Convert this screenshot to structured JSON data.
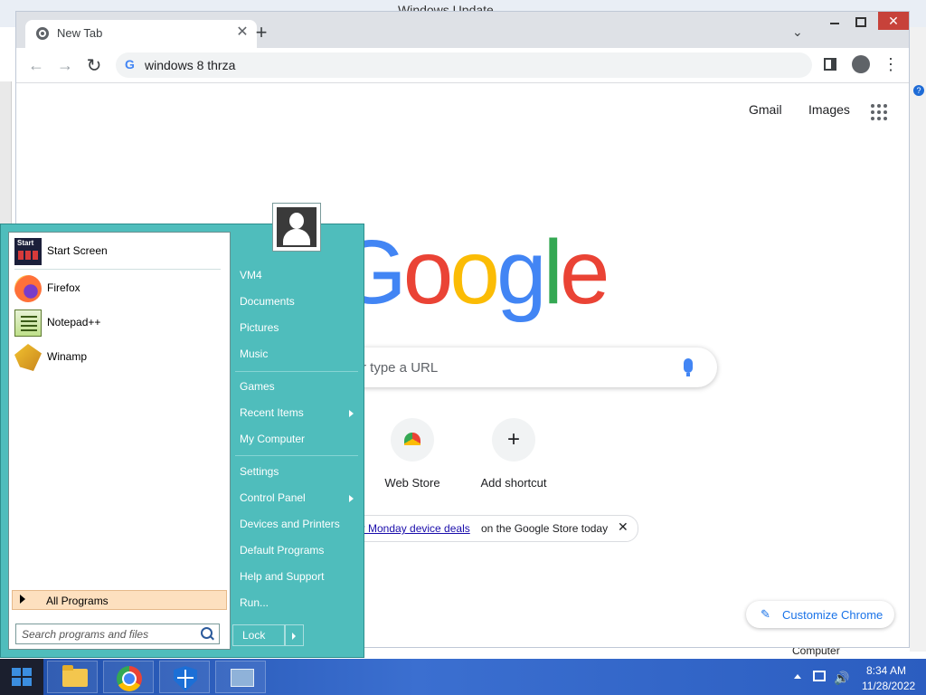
{
  "background_window": {
    "title": "Windows Update",
    "computer_label": "Computer",
    "help_glyph": "?"
  },
  "browser": {
    "tab": {
      "title": "New Tab",
      "close_glyph": "✕"
    },
    "new_tab_glyph": "+",
    "tab_search_glyph": "⌄",
    "close_glyph": "✕",
    "nav": {
      "back_glyph": "←",
      "forward_glyph": "→",
      "reload_glyph": "↻"
    },
    "omnibox": {
      "g_glyph": "G",
      "value": "windows 8 thrza"
    },
    "menu_glyph": "⋮",
    "top_links": {
      "gmail": "Gmail",
      "images": "Images"
    },
    "logo_letters": [
      {
        "ch": "G",
        "color": "#4285f4"
      },
      {
        "ch": "o",
        "color": "#ea4335"
      },
      {
        "ch": "o",
        "color": "#fbbc05"
      },
      {
        "ch": "g",
        "color": "#4285f4"
      },
      {
        "ch": "l",
        "color": "#34a853"
      },
      {
        "ch": "e",
        "color": "#ea4335"
      }
    ],
    "search_placeholder": "r type a URL",
    "shortcuts": [
      {
        "label": "Web Store",
        "icon": "webstore-icon"
      },
      {
        "label": "Add shortcut",
        "icon": "plus-icon",
        "glyph": "+"
      }
    ],
    "notice": {
      "link": "er Monday device deals",
      "rest": "on the Google Store today",
      "close_glyph": "✕"
    },
    "customize": {
      "label": "Customize Chrome",
      "pen_glyph": "✎"
    }
  },
  "start_menu": {
    "pinned": [
      {
        "label": "Start Screen",
        "icon": "start-screen-icon"
      },
      {
        "label": "Firefox",
        "icon": "firefox-icon"
      },
      {
        "label": "Notepad++",
        "icon": "notepad-plus-plus-icon"
      },
      {
        "label": "Winamp",
        "icon": "winamp-icon"
      }
    ],
    "all_programs": "All Programs",
    "search_placeholder": "Search programs and files",
    "links": [
      {
        "label": "VM4"
      },
      {
        "label": "Documents"
      },
      {
        "label": "Pictures"
      },
      {
        "label": "Music"
      },
      {
        "label": "Games"
      },
      {
        "label": "Recent Items",
        "submenu": true
      },
      {
        "label": "My Computer"
      },
      {
        "label": "Settings"
      },
      {
        "label": "Control Panel",
        "submenu": true
      },
      {
        "label": "Devices and Printers"
      },
      {
        "label": "Default Programs"
      },
      {
        "label": "Help and Support"
      },
      {
        "label": "Run..."
      }
    ],
    "lock_label": "Lock"
  },
  "taskbar": {
    "pinned": [
      "file-explorer-icon",
      "chrome-icon",
      "windows-defender-icon",
      "control-panel-icon"
    ],
    "clock": {
      "time": "8:34 AM",
      "date": "11/28/2022"
    },
    "volume_glyph": "🔊"
  }
}
